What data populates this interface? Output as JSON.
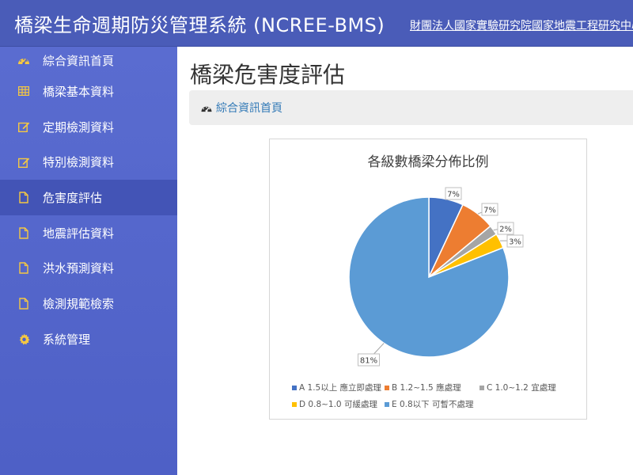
{
  "header": {
    "title": "橋梁生命週期防災管理系統 (NCREE-BMS)",
    "org": "財團法人國家實驗研究院國家地震工程研究中心"
  },
  "sidebar": {
    "items": [
      {
        "label": "綜合資訊首頁",
        "icon": "dashboard-icon"
      },
      {
        "label": "橋梁基本資料",
        "icon": "table-icon"
      },
      {
        "label": "定期檢測資料",
        "icon": "edit-icon"
      },
      {
        "label": "特別檢測資料",
        "icon": "edit-icon"
      },
      {
        "label": "危害度評估",
        "icon": "file-icon",
        "active": true
      },
      {
        "label": "地震評估資料",
        "icon": "file-icon"
      },
      {
        "label": "洪水預測資料",
        "icon": "file-icon"
      },
      {
        "label": "檢測規範檢索",
        "icon": "file-icon"
      },
      {
        "label": "系統管理",
        "icon": "gear-icon"
      }
    ]
  },
  "main": {
    "page_title": "橋梁危害度評估",
    "breadcrumb": {
      "label": "綜合資訊首頁",
      "icon": "dashboard-icon"
    }
  },
  "colors": {
    "header_bg": "#4a5cb8",
    "sidebar_bg": "#5a6cd0",
    "sidebar_active": "#4354b6",
    "link": "#337ab7"
  },
  "chart_data": {
    "type": "pie",
    "title": "各級數橋梁分佈比例",
    "slices": [
      {
        "name": "A 1.5以上 應立即處理",
        "value": 7,
        "label": "7%",
        "color": "#4472c4"
      },
      {
        "name": "B 1.2~1.5 應處理",
        "value": 7,
        "label": "7%",
        "color": "#ed7d31"
      },
      {
        "name": "C 1.0~1.2 宜處理",
        "value": 2,
        "label": "2%",
        "color": "#a5a5a5"
      },
      {
        "name": "D 0.8~1.0 可緩處理",
        "value": 3,
        "label": "3%",
        "color": "#ffc000"
      },
      {
        "name": "E 0.8以下 可暫不處理",
        "value": 81,
        "label": "81%",
        "color": "#5b9bd5"
      }
    ],
    "legend_position": "bottom"
  }
}
